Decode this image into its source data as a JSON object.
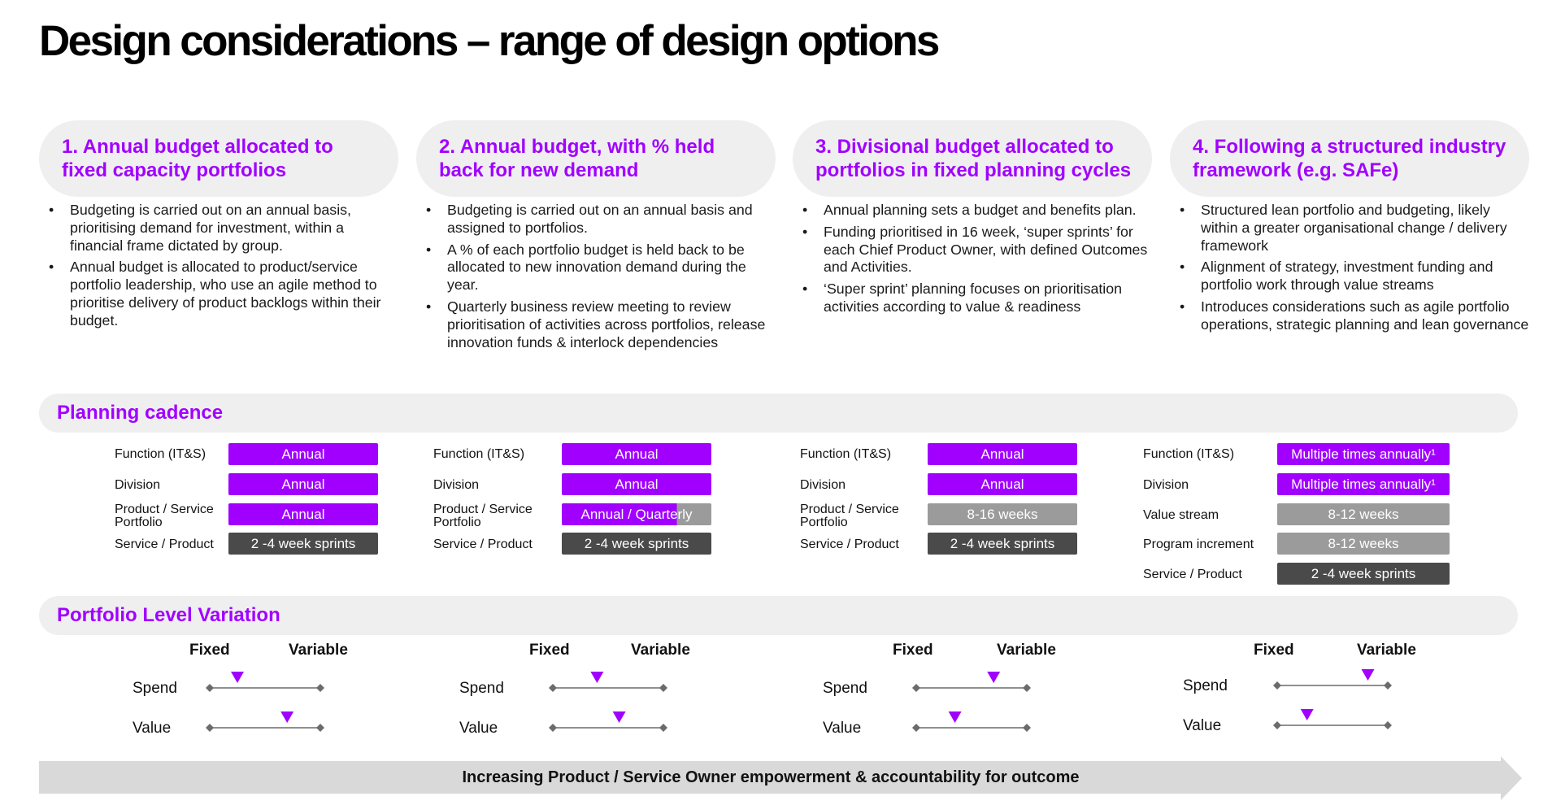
{
  "title": "Design considerations – range of design options",
  "options": [
    {
      "label": "1. Annual budget allocated to fixed capacity portfolios",
      "bullets": [
        "Budgeting is carried out on an annual basis, prioritising demand for investment, within a financial frame dictated by group.",
        "Annual budget is allocated to product/service portfolio leadership, who use an agile method to prioritise delivery of product backlogs within their budget."
      ]
    },
    {
      "label": "2. Annual budget, with % held back for new demand",
      "bullets": [
        "Budgeting is carried out on an annual basis and assigned to portfolios.",
        "A % of each portfolio budget is held back to be allocated to new innovation demand during the year.",
        "Quarterly business review meeting to review prioritisation of activities across portfolios, release innovation funds & interlock dependencies"
      ]
    },
    {
      "label": "3. Divisional budget allocated to portfolios in fixed planning cycles",
      "bullets": [
        "Annual planning sets a budget and benefits plan.",
        "Funding prioritised in 16 week, ‘super sprints’ for each Chief Product Owner, with defined Outcomes and Activities.",
        "‘Super sprint’ planning focuses on prioritisation activities according to value & readiness"
      ]
    },
    {
      "label": "4. Following a structured industry framework (e.g. SAFe)",
      "bullets": [
        "Structured lean portfolio and budgeting, likely within a greater organisational change / delivery framework",
        "Alignment of strategy, investment funding and portfolio work through value streams",
        "Introduces considerations such as agile portfolio operations, strategic planning and lean governance"
      ]
    }
  ],
  "planning_cadence": {
    "label": "Planning cadence",
    "columns": [
      {
        "rows": [
          {
            "label": "Function (IT&S)",
            "value": "Annual",
            "style": "purple"
          },
          {
            "label": "Division",
            "value": "Annual",
            "style": "purple"
          },
          {
            "label": "Product / Service Portfolio",
            "value": "Annual",
            "style": "purple"
          },
          {
            "label": "Service / Product",
            "value": "2 -4 week sprints",
            "style": "dgrey"
          }
        ]
      },
      {
        "rows": [
          {
            "label": "Function (IT&S)",
            "value": "Annual",
            "style": "purple"
          },
          {
            "label": "Division",
            "value": "Annual",
            "style": "purple"
          },
          {
            "label": "Product / Service Portfolio",
            "value": "Annual / Quarterly",
            "style": "split"
          },
          {
            "label": "Service / Product",
            "value": "2 -4 week sprints",
            "style": "dgrey"
          }
        ]
      },
      {
        "rows": [
          {
            "label": "Function (IT&S)",
            "value": "Annual",
            "style": "purple"
          },
          {
            "label": "Division",
            "value": "Annual",
            "style": "purple"
          },
          {
            "label": "Product / Service Portfolio",
            "value": "8-16 weeks",
            "style": "lgrey"
          },
          {
            "label": "Service / Product",
            "value": "2 -4 week sprints",
            "style": "dgrey"
          }
        ]
      },
      {
        "rows": [
          {
            "label": "Function (IT&S)",
            "value": "Multiple times annually¹",
            "style": "purple"
          },
          {
            "label": "Division",
            "value": "Multiple times annually¹",
            "style": "purple"
          },
          {
            "label": "Value stream",
            "value": "8-12 weeks",
            "style": "lgrey"
          },
          {
            "label": "Program increment",
            "value": "8-12 weeks",
            "style": "lgrey"
          },
          {
            "label": "Service / Product",
            "value": "2 -4 week sprints",
            "style": "dgrey"
          }
        ]
      }
    ]
  },
  "portfolio_variation": {
    "label": "Portfolio Level Variation",
    "fixed_label": "Fixed",
    "variable_label": "Variable",
    "spend_label": "Spend",
    "value_label": "Value",
    "columns": [
      {
        "spend": 0.25,
        "value": 0.7
      },
      {
        "spend": 0.4,
        "value": 0.6
      },
      {
        "spend": 0.7,
        "value": 0.35
      },
      {
        "spend": 0.82,
        "value": 0.27
      }
    ]
  },
  "footer_arrow": "Increasing Product / Service Owner empowerment & accountability for outcome",
  "colors": {
    "accent": "#a100ff",
    "light_grey_pill": "#9b9b9b",
    "dark_grey_pill": "#4a4a4a",
    "band": "#efefef"
  }
}
